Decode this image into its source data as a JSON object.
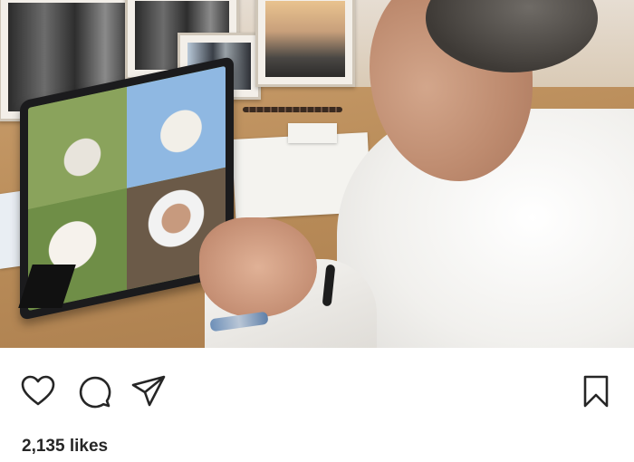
{
  "post": {
    "photo_icon": "post-photo",
    "likes_text": "2,135 likes"
  },
  "actions": {
    "like_icon": "heart-icon",
    "comment_icon": "comment-icon",
    "share_icon": "send-icon",
    "save_icon": "bookmark-icon"
  },
  "colors": {
    "icon": "#262626",
    "background": "#ffffff"
  }
}
